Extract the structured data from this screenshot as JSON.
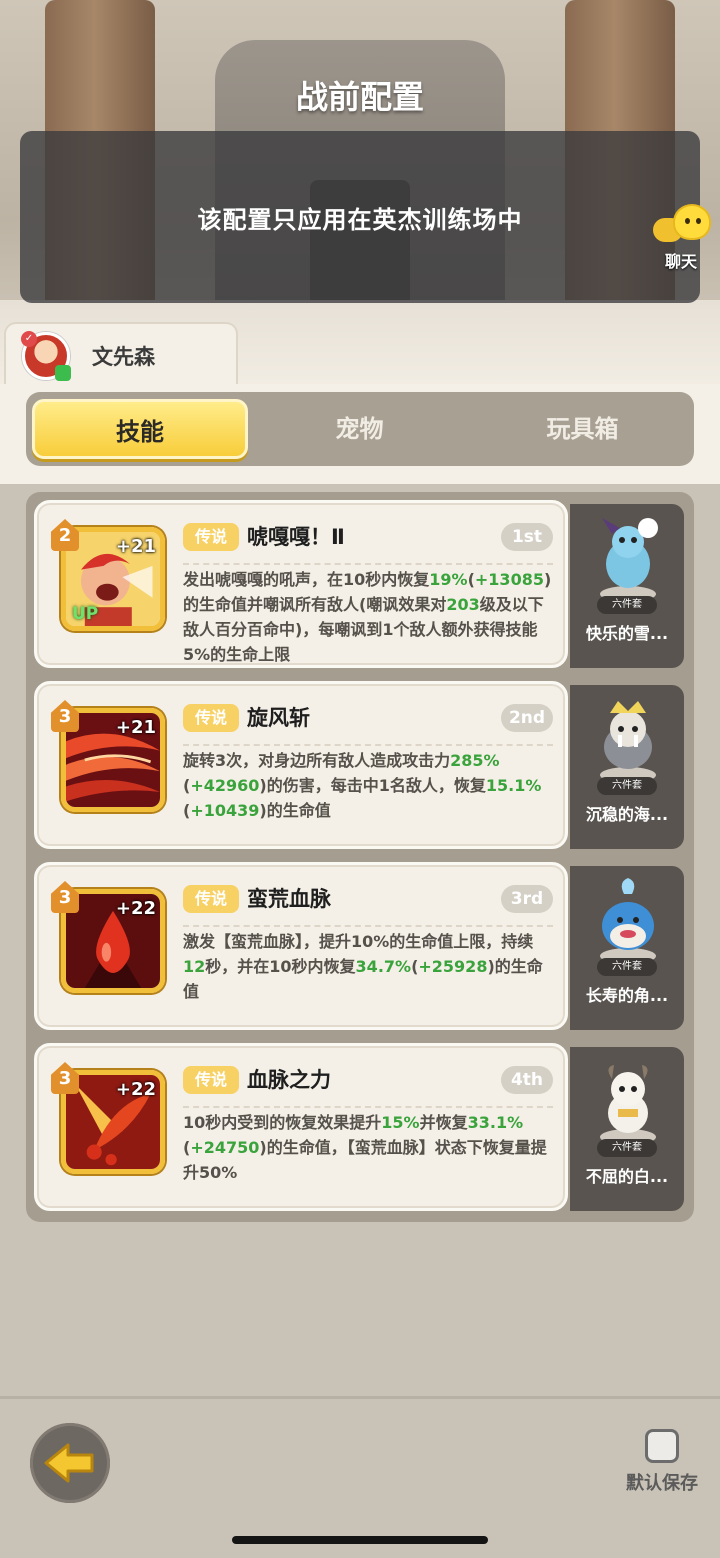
{
  "header": {
    "title": "战前配置",
    "notice": "该配置只应用在英杰训练场中",
    "chat_label": "聊天"
  },
  "hero": {
    "name": "文先森"
  },
  "tabs": [
    {
      "label": "技能",
      "active": true
    },
    {
      "label": "宠物",
      "active": false
    },
    {
      "label": "玩具箱",
      "active": false
    }
  ],
  "skills": [
    {
      "level": "2",
      "bonus": "+21",
      "upgrade": "UP",
      "rarity": "传说",
      "name": "唬嘎嘎！Ⅱ",
      "rank": "1st",
      "desc": [
        {
          "t": "发出唬嘎嘎的吼声，在10秒内恢复"
        },
        {
          "t": "19%",
          "g": true
        },
        {
          "t": "("
        },
        {
          "t": "+13085",
          "g": true
        },
        {
          "t": ")的生命值并嘲讽所有敌人(嘲讽效果对"
        },
        {
          "t": "203",
          "g": true
        },
        {
          "t": "级及以下敌人百分百命中)，每嘲讽到1个敌人额外获得技能5%的生命上限"
        }
      ],
      "pet": {
        "badge": "六件套",
        "name": "快乐的雪..."
      }
    },
    {
      "level": "3",
      "bonus": "+21",
      "upgrade": "",
      "rarity": "传说",
      "name": "旋风斩",
      "rank": "2nd",
      "desc": [
        {
          "t": "旋转3次，对身边所有敌人造成攻击力"
        },
        {
          "t": "285%",
          "g": true
        },
        {
          "t": "("
        },
        {
          "t": "+42960",
          "g": true
        },
        {
          "t": ")的伤害，每击中1名敌人，恢复"
        },
        {
          "t": "15.1%",
          "g": true
        },
        {
          "t": "("
        },
        {
          "t": "+10439",
          "g": true
        },
        {
          "t": ")的生命值"
        }
      ],
      "pet": {
        "badge": "六件套",
        "name": "沉稳的海..."
      }
    },
    {
      "level": "3",
      "bonus": "+22",
      "upgrade": "",
      "rarity": "传说",
      "name": "蛮荒血脉",
      "rank": "3rd",
      "desc": [
        {
          "t": "激发【蛮荒血脉】，提升10%的生命值上限，持续"
        },
        {
          "t": "12",
          "g": true
        },
        {
          "t": "秒，并在10秒内恢复"
        },
        {
          "t": "34.7%",
          "g": true
        },
        {
          "t": "("
        },
        {
          "t": "+25928",
          "g": true
        },
        {
          "t": ")的生命值"
        }
      ],
      "pet": {
        "badge": "六件套",
        "name": "长寿的角..."
      }
    },
    {
      "level": "3",
      "bonus": "+22",
      "upgrade": "",
      "rarity": "传说",
      "name": "血脉之力",
      "rank": "4th",
      "desc": [
        {
          "t": "10秒内受到的恢复效果提升"
        },
        {
          "t": "15%",
          "g": true
        },
        {
          "t": "并恢复"
        },
        {
          "t": "33.1%",
          "g": true
        },
        {
          "t": "("
        },
        {
          "t": "+24750",
          "g": true
        },
        {
          "t": ")的生命值，【蛮荒血脉】状态下恢复量提升50%"
        }
      ],
      "pet": {
        "badge": "六件套",
        "name": "不屈的白..."
      }
    }
  ],
  "footer": {
    "save_label": "默认保存",
    "save_checked": false
  },
  "colors": {
    "accent": "#f8cd3a",
    "highlight_green": "#3aa33c",
    "rarity_gold": "#f7d164"
  }
}
